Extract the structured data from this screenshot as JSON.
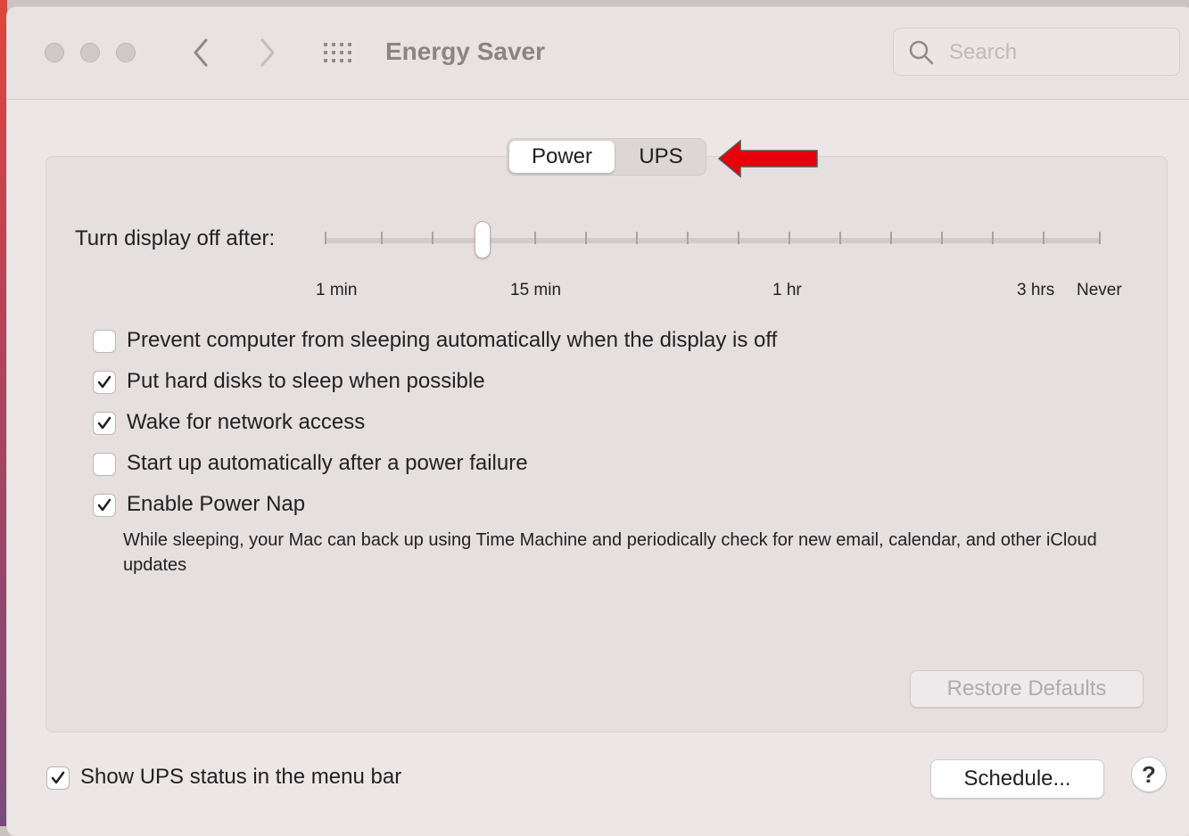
{
  "window": {
    "title": "Energy Saver"
  },
  "search": {
    "placeholder": "Search"
  },
  "tabs": {
    "power_label": "Power",
    "ups_label": "UPS",
    "selected": "Power"
  },
  "display_slider": {
    "label": "Turn display off after:",
    "tick_labels": [
      "1 min",
      "15 min",
      "1 hr",
      "3 hrs",
      "Never"
    ],
    "selected_value": "15 min"
  },
  "options": [
    {
      "label": "Prevent computer from sleeping automatically when the display is off",
      "checked": false
    },
    {
      "label": "Put hard disks to sleep when possible",
      "checked": true
    },
    {
      "label": "Wake for network access",
      "checked": true
    },
    {
      "label": "Start up automatically after a power failure",
      "checked": false
    },
    {
      "label": "Enable Power Nap",
      "checked": true
    }
  ],
  "power_nap_description": "While sleeping, your Mac can back up using Time Machine and periodically check for new email, calendar, and other iCloud updates",
  "restore_defaults_label": "Restore Defaults",
  "ups_status": {
    "label": "Show UPS status in the menu bar",
    "checked": true
  },
  "schedule_label": "Schedule...",
  "help_label": "?",
  "colors": {
    "annotation_arrow": "#e8000b",
    "window_bg": "#ece6e7"
  }
}
